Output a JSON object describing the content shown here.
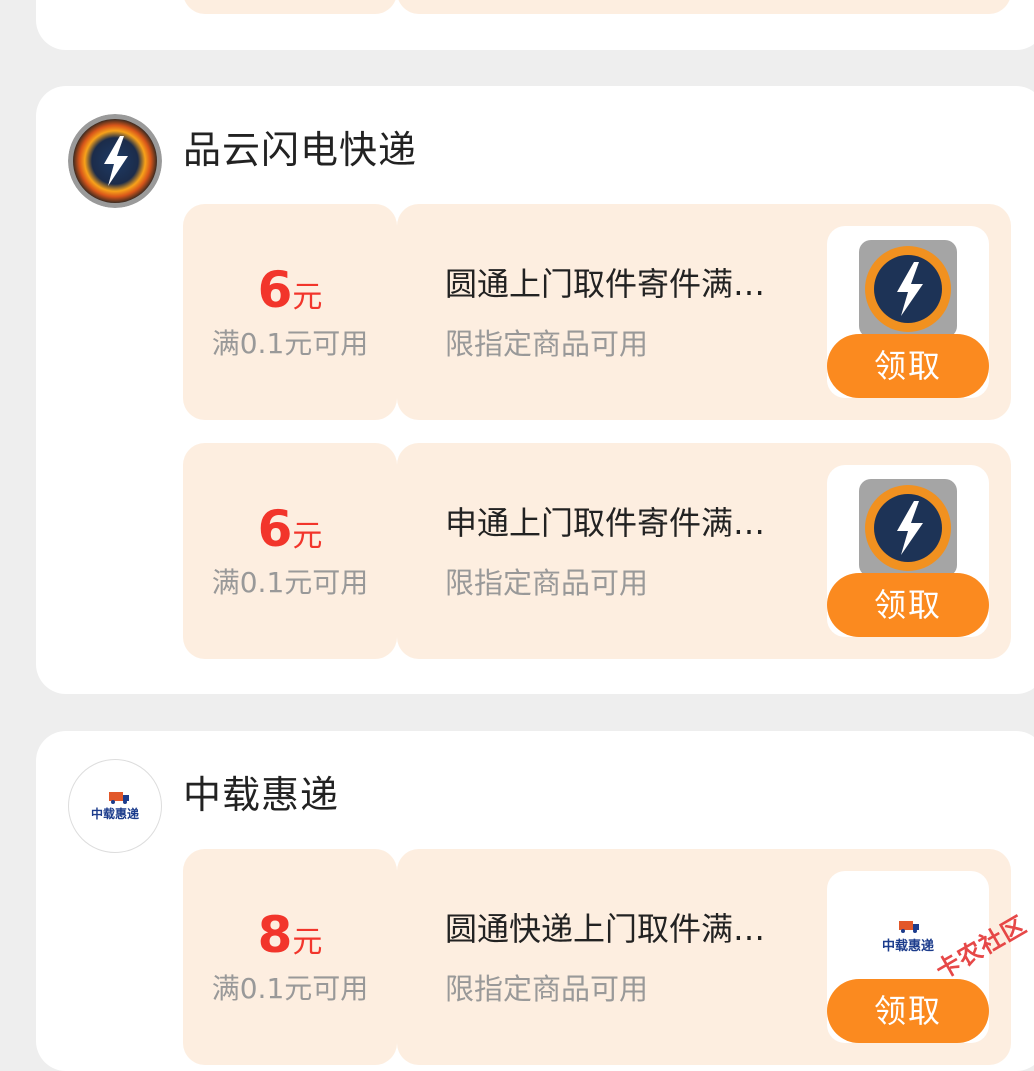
{
  "stores": [
    {
      "name": "品云闪电快递",
      "logo": "lightning-logo",
      "coupons": [
        {
          "amount": "6",
          "unit": "元",
          "condition": "满0.1元可用",
          "title": "圆通上门取件寄件满…",
          "subtitle": "限指定商品可用",
          "button": "领取"
        },
        {
          "amount": "6",
          "unit": "元",
          "condition": "满0.1元可用",
          "title": "申通上门取件寄件满…",
          "subtitle": "限指定商品可用",
          "button": "领取"
        }
      ]
    },
    {
      "name": "中载惠递",
      "logo": "truck-logo",
      "logo_text": "中载惠递",
      "coupons": [
        {
          "amount": "8",
          "unit": "元",
          "condition": "满0.1元可用",
          "title": "圆通快递上门取件满…",
          "subtitle": "限指定商品可用",
          "button": "领取"
        }
      ]
    }
  ],
  "watermark": "卡农社区",
  "colors": {
    "accent": "#fb8a1f",
    "price": "#f2352b",
    "coupon_bg": "#fdeee0",
    "page_bg": "#eeeeee"
  }
}
